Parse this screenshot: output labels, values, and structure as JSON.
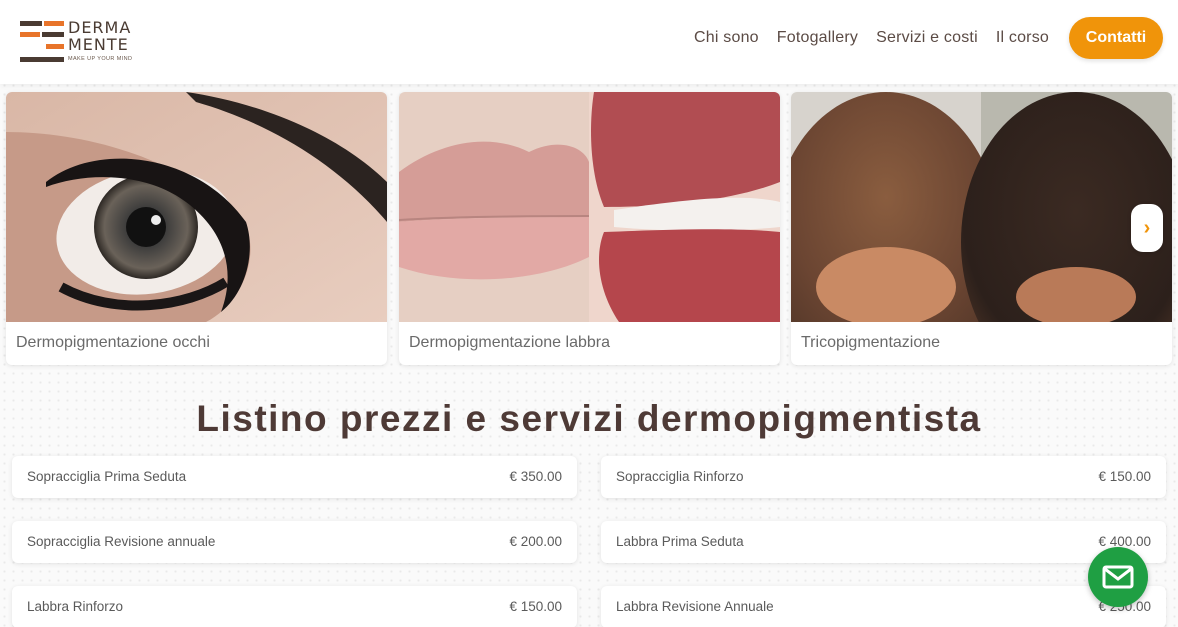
{
  "brand": {
    "line1": "DERMA",
    "line2": "MENTE",
    "tagline": "MAKE UP YOUR MIND"
  },
  "nav": {
    "items": [
      "Chi sono",
      "Fotogallery",
      "Servizi e costi",
      "Il corso"
    ],
    "cta": "Contatti"
  },
  "carousel": {
    "cards": [
      {
        "label": "Dermopigmentazione occhi",
        "icon": "eye-photo"
      },
      {
        "label": "Dermopigmentazione labbra",
        "icon": "lips-before-after-photo"
      },
      {
        "label": "Tricopigmentazione",
        "icon": "scalp-before-after-photo"
      }
    ],
    "next_symbol": "›"
  },
  "pricing": {
    "title": "Listino prezzi e servizi dermopigmentista",
    "rows": [
      {
        "name": "Sopracciglia Prima Seduta",
        "price": "€ 350.00"
      },
      {
        "name": "Sopracciglia Rinforzo",
        "price": "€ 150.00"
      },
      {
        "name": "Sopracciglia Revisione annuale",
        "price": "€ 200.00"
      },
      {
        "name": "Labbra Prima Seduta",
        "price": "€ 400.00"
      },
      {
        "name": "Labbra Rinforzo",
        "price": "€ 150.00"
      },
      {
        "name": "Labbra Revisione Annuale",
        "price": "€ 250.00"
      }
    ]
  },
  "fab": {
    "icon": "mail-icon"
  },
  "colors": {
    "accent": "#f0940a",
    "brand_dark": "#4a3b32",
    "fab": "#1f9f43",
    "logo_orange": "#e8742a"
  }
}
